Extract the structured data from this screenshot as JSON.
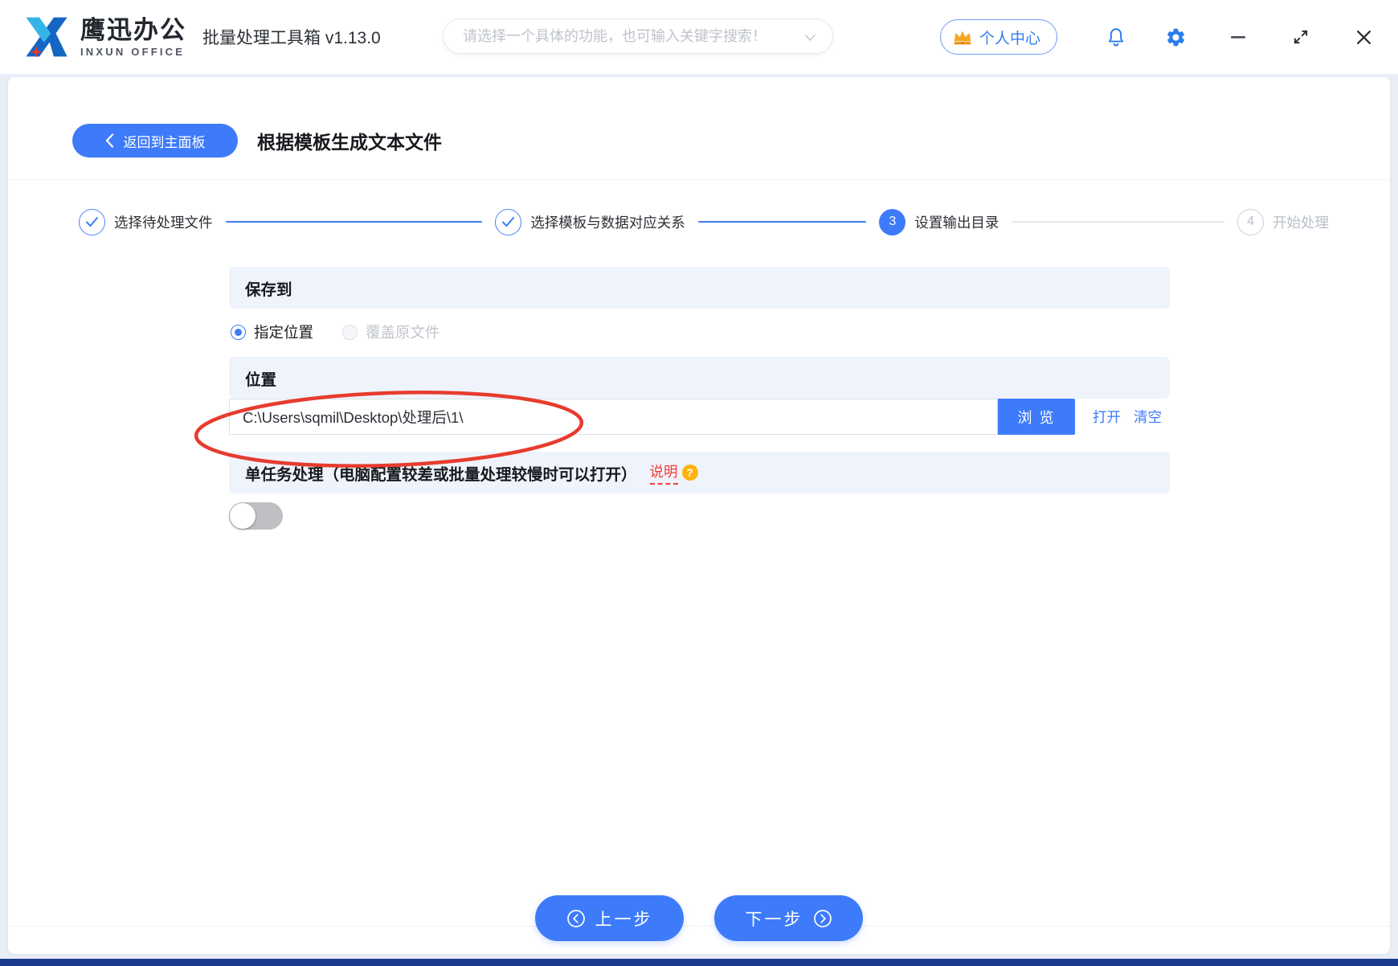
{
  "window": {
    "brand_cn": "鹰迅办公",
    "brand_en": "INXUN OFFICE",
    "app_title": "批量处理工具箱 v1.13.0",
    "search_placeholder": "请选择一个具体的功能，也可输入关键字搜索！",
    "user_center_label": "个人中心"
  },
  "page": {
    "back_button": "返回到主面板",
    "title": "根据模板生成文本文件"
  },
  "steps": [
    {
      "label": "选择待处理文件",
      "state": "done"
    },
    {
      "label": "选择模板与数据对应关系",
      "state": "done"
    },
    {
      "number": "3",
      "label": "设置输出目录",
      "state": "current"
    },
    {
      "number": "4",
      "label": "开始处理",
      "state": "pending"
    }
  ],
  "save_to": {
    "header": "保存到",
    "options": [
      {
        "label": "指定位置",
        "selected": true
      },
      {
        "label": "覆盖原文件",
        "selected": false,
        "disabled": true
      }
    ]
  },
  "location": {
    "header": "位置",
    "path_value": "C:\\Users\\sqmil\\Desktop\\处理后\\1\\",
    "browse_button": "浏 览",
    "open_link": "打开",
    "clear_link": "清空"
  },
  "single_task": {
    "header": "单任务处理（电脑配置较差或批量处理较慢时可以打开）",
    "help_link": "说明",
    "help_icon": "?",
    "toggle_on": false
  },
  "footer": {
    "prev_button": "上一步",
    "next_button": "下一步"
  },
  "colors": {
    "primary_blue": "#3e7bfa",
    "icon_blue": "#2b7de9",
    "annotation_red": "#e63c2e",
    "help_orange": "#ffb30f",
    "section_bg": "#eff3fc",
    "bottom_strip": "#1a3a8c"
  }
}
